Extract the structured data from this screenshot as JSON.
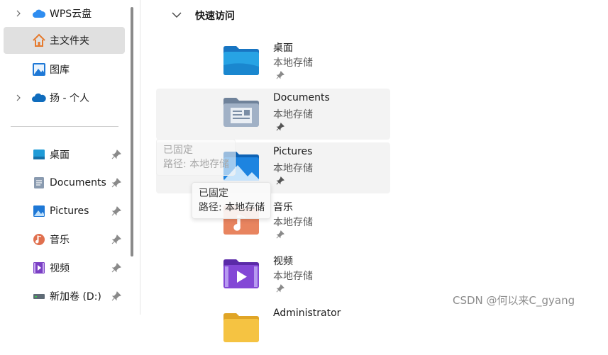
{
  "sidebar": {
    "items": [
      {
        "label": "WPS云盘",
        "icon": "cloud-icon",
        "chevron": true
      },
      {
        "label": "主文件夹",
        "icon": "home-icon",
        "selected": true
      },
      {
        "label": "图库",
        "icon": "gallery-icon"
      },
      {
        "label": "扬 - 个人",
        "icon": "onedrive-icon",
        "chevron": true
      },
      {
        "label": "桌面",
        "icon": "desktop-icon",
        "pinned": true
      },
      {
        "label": "Documents",
        "icon": "documents-icon",
        "pinned": true
      },
      {
        "label": "Pictures",
        "icon": "pictures-icon",
        "pinned": true
      },
      {
        "label": "音乐",
        "icon": "music-icon",
        "pinned": true
      },
      {
        "label": "视频",
        "icon": "video-icon",
        "pinned": true
      },
      {
        "label": "新加卷 (D:)",
        "icon": "drive-icon",
        "pinned": true
      }
    ]
  },
  "main": {
    "section_title": "快速访问",
    "tiles": [
      {
        "name": "桌面",
        "sub": "本地存储",
        "icon": "desktop-folder-icon"
      },
      {
        "name": "Documents",
        "sub": "本地存储",
        "icon": "documents-folder-icon",
        "hover": true
      },
      {
        "name": "Pictures",
        "sub": "本地存储",
        "icon": "pictures-folder-icon",
        "hover": true
      },
      {
        "name": "音乐",
        "sub": "本地存储",
        "icon": "music-folder-icon"
      },
      {
        "name": "视频",
        "sub": "本地存储",
        "icon": "video-folder-icon"
      },
      {
        "name": "Administrator",
        "sub": "",
        "icon": "user-folder-icon"
      }
    ]
  },
  "tooltips": [
    {
      "line1": "已固定",
      "line2": "路径: 本地存储"
    },
    {
      "line1": "已固定",
      "line2": "路径: 本地存储"
    }
  ],
  "watermark": "CSDN @何以来C_gyang",
  "colors": {
    "accent": "#1a8fe3",
    "selected_bg": "#e0e0e0",
    "hover_bg": "#f3f3f3"
  }
}
